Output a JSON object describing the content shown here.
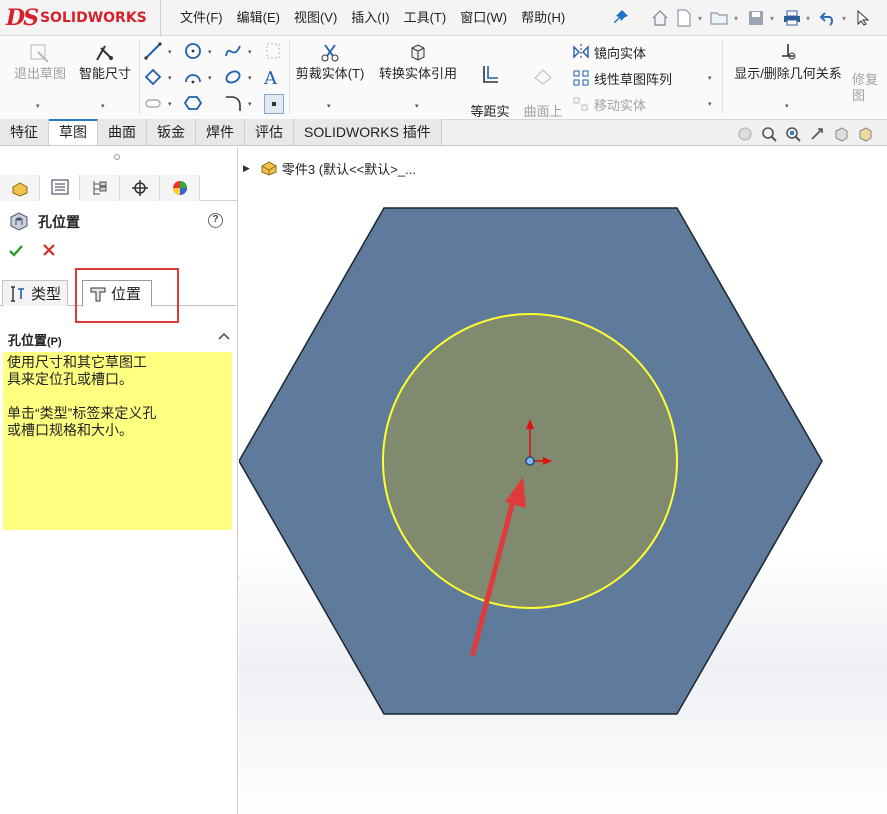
{
  "app": {
    "logo_prefix": "DS",
    "logo_text": "SOLIDWORKS"
  },
  "menu": [
    "文件(F)",
    "编辑(E)",
    "视图(V)",
    "插入(I)",
    "工具(T)",
    "窗口(W)",
    "帮助(H)"
  ],
  "ribbon": {
    "exit_sketch": "退出草图",
    "smart_dimension": "智能尺寸",
    "trim_entities": "剪裁实体(T)",
    "convert_entities": "转换实体引用",
    "offset_entities": "等距实\n体",
    "offset_on_surface": "曲面上\n偏移",
    "mirror_entities": "镜向实体",
    "linear_pattern": "线性草图阵列",
    "move_entities": "移动实体",
    "display_relations": "显示/删除几何关系",
    "repair_sketch": "修复\n图"
  },
  "tabs": [
    "特征",
    "草图",
    "曲面",
    "钣金",
    "焊件",
    "评估",
    "SOLIDWORKS 插件"
  ],
  "active_tab": "草图",
  "tree": {
    "part_label": "零件3  (默认<<默认>_..."
  },
  "property_manager": {
    "title": "孔位置",
    "help": "?",
    "subtabs": {
      "type": "类型",
      "position": "位置"
    },
    "active_subtab": "位置",
    "group_title": "孔位置",
    "group_title_suffix": "(P)",
    "message": "使用尺寸和其它草图工\n具来定位孔或槽口。\n\n单击“类型”标签来定义孔\n或槽口规格和大小。"
  },
  "colors": {
    "hexagon_fill": "#5e7b9b",
    "circle_fill": "#7f8a6e",
    "circle_stroke": "#ffff33",
    "message_bg": "#ffff80",
    "annotation_red": "#e03a3a",
    "logo_red": "#d8202a"
  },
  "icons": {
    "annotation": "red-arrow-pointing-to-origin",
    "highlight": "red-rectangle-around-position-tab"
  }
}
